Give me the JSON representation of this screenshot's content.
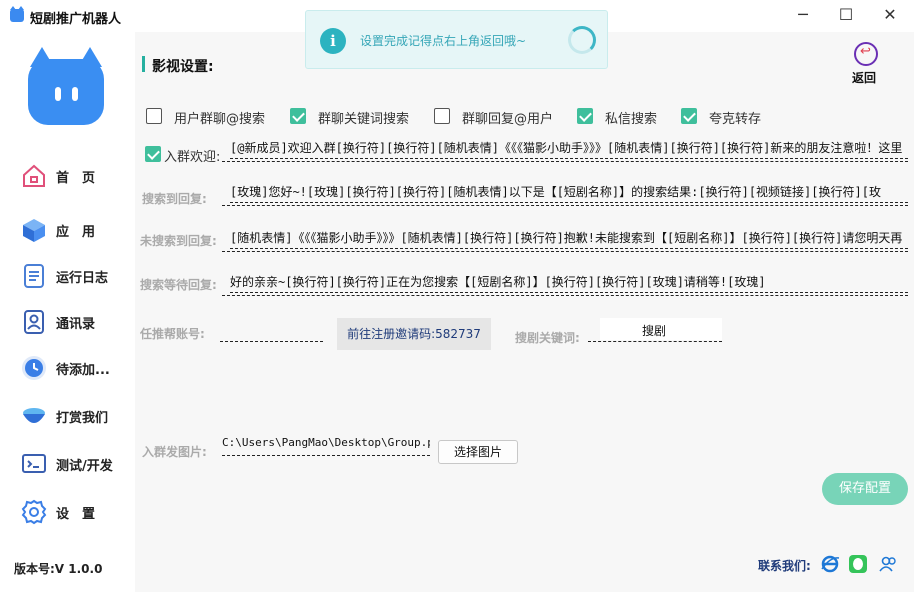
{
  "window": {
    "title": "短剧推广机器人",
    "minimize": "─",
    "maximize": "☐",
    "close": "✕"
  },
  "sidebar": {
    "items": [
      {
        "label": "首　页",
        "icon": "home-icon"
      },
      {
        "label": "应　用",
        "icon": "cube-icon"
      },
      {
        "label": "运行日志",
        "icon": "log-icon"
      },
      {
        "label": "通讯录",
        "icon": "contacts-icon"
      },
      {
        "label": "待添加...",
        "icon": "clock-icon"
      },
      {
        "label": "打赏我们",
        "icon": "donate-icon"
      },
      {
        "label": "测试/开发",
        "icon": "terminal-icon"
      },
      {
        "label": "设　置",
        "icon": "gear-icon"
      }
    ],
    "version": "版本号:V 1.0.0"
  },
  "toast": {
    "icon": "i",
    "text": "设置完成记得点右上角返回哦~"
  },
  "section": {
    "title": "影视设置:",
    "back_label": "返回"
  },
  "options": [
    {
      "label": "用户群聊@搜索",
      "checked": false
    },
    {
      "label": "群聊关键词搜索",
      "checked": true
    },
    {
      "label": "群聊回复@用户",
      "checked": false
    },
    {
      "label": "私信搜索",
      "checked": true
    },
    {
      "label": "夸克转存",
      "checked": true
    }
  ],
  "welcome": {
    "label": "入群欢迎:",
    "checked": true,
    "value": "[@新成员]欢迎入群[换行符][换行符][随机表情]《《《猫影小助手》》》[随机表情][换行符][换行符]新来的朋友注意啦！这里"
  },
  "search_reply": {
    "label": "搜索到回复:",
    "value": "[玫瑰]您好~![玫瑰][换行符][换行符][随机表情]以下是【[短剧名称]】的搜索结果:[换行符][视频链接][换行符][玫"
  },
  "not_found_reply": {
    "label": "未搜索到回复:",
    "value": "[随机表情]《《《猫影小助手》》》[随机表情][换行符][换行符]抱歉!未能搜索到【[短剧名称]】[换行符][换行符]请您明天再"
  },
  "waiting_reply": {
    "label": "搜索等待回复:",
    "value": "好的亲亲~[换行符][换行符]正在为您搜索【[短剧名称]】[换行符][换行符][玫瑰]请稍等![玫瑰]"
  },
  "promo": {
    "label": "任推帮账号:",
    "invite_button": "前往注册邀请码:582737",
    "keyword_label": "搜剧关键词:",
    "keyword_value": "搜剧"
  },
  "image": {
    "label": "入群发图片:",
    "path": "C:\\Users\\PangMao\\Desktop\\Group.png",
    "pick_button": "选择图片"
  },
  "save_button": "保存配置",
  "contact": {
    "label": "联系我们:",
    "icons": [
      "ie-icon",
      "qq-icon",
      "user-group-icon"
    ]
  },
  "colors": {
    "accent": "#26b0a0",
    "checkbox": "#3fbf9c",
    "save": "#78d4b8",
    "toast_text": "#35a6b7",
    "brand_blue": "#3a8ef2"
  }
}
